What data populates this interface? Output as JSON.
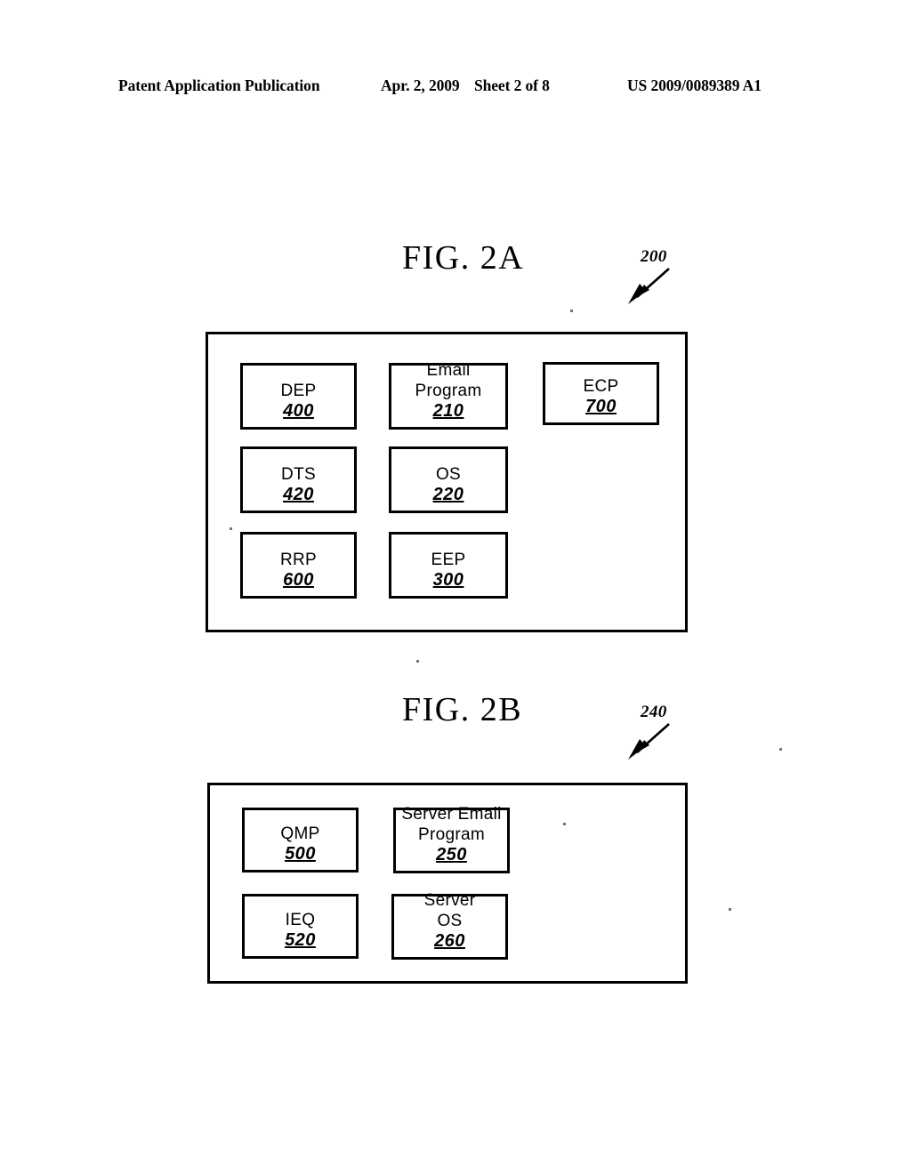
{
  "header": {
    "publication": "Patent Application Publication",
    "date": "Apr. 2, 2009",
    "sheet": "Sheet 2 of 8",
    "patent_number": "US 2009/0089389 A1"
  },
  "figures": [
    {
      "id": "fig-2a",
      "title": "FIG. 2A",
      "reference_numeral": "200",
      "components": [
        {
          "label": "DEP",
          "number": "400"
        },
        {
          "label": "Email\nProgram",
          "number": "210"
        },
        {
          "label": "ECP",
          "number": "700"
        },
        {
          "label": "DTS",
          "number": "420"
        },
        {
          "label": "OS",
          "number": "220"
        },
        {
          "label": "RRP",
          "number": "600"
        },
        {
          "label": "EEP",
          "number": "300"
        }
      ]
    },
    {
      "id": "fig-2b",
      "title": "FIG. 2B",
      "reference_numeral": "240",
      "components": [
        {
          "label": "QMP",
          "number": "500"
        },
        {
          "label": "Server Email\nProgram",
          "number": "250"
        },
        {
          "label": "IEQ",
          "number": "520"
        },
        {
          "label": "Server\nOS",
          "number": "260"
        }
      ]
    }
  ],
  "colors": {
    "ink": "#000000",
    "paper": "#ffffff"
  }
}
